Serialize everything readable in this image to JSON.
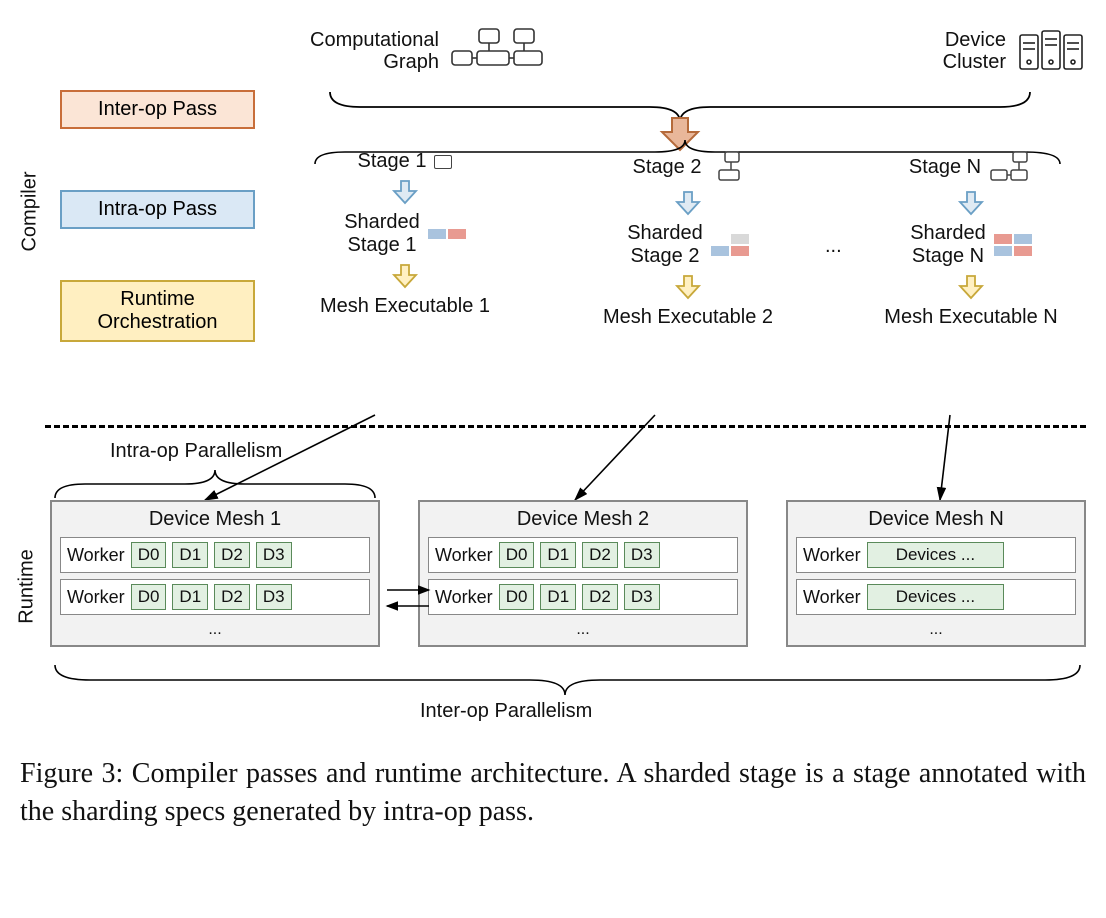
{
  "side_labels": {
    "compiler": "Compiler",
    "runtime": "Runtime"
  },
  "legend": {
    "inter": "Inter-op Pass",
    "intra": "Intra-op Pass",
    "runtime": "Runtime\nOrchestration"
  },
  "top": {
    "comp_graph": "Computational\nGraph",
    "device_cluster": "Device\nCluster"
  },
  "stages": [
    {
      "name": "Stage 1",
      "sharded": "Sharded\nStage 1",
      "mesh_exec": "Mesh Executable 1"
    },
    {
      "name": "Stage 2",
      "sharded": "Sharded\nStage 2",
      "mesh_exec": "Mesh Executable 2"
    },
    {
      "name": "Stage N",
      "sharded": "Sharded\nStage N",
      "mesh_exec": "Mesh Executable N"
    }
  ],
  "ellipsis": "...",
  "intraop_label": "Intra-op Parallelism",
  "meshes": [
    {
      "title": "Device Mesh 1",
      "workers": [
        {
          "label": "Worker",
          "devices": [
            "D0",
            "D1",
            "D2",
            "D3"
          ]
        },
        {
          "label": "Worker",
          "devices": [
            "D0",
            "D1",
            "D2",
            "D3"
          ]
        }
      ]
    },
    {
      "title": "Device Mesh 2",
      "workers": [
        {
          "label": "Worker",
          "devices": [
            "D0",
            "D1",
            "D2",
            "D3"
          ]
        },
        {
          "label": "Worker",
          "devices": [
            "D0",
            "D1",
            "D2",
            "D3"
          ]
        }
      ]
    },
    {
      "title": "Device Mesh N",
      "workers": [
        {
          "label": "Worker",
          "devices_single": "Devices ..."
        },
        {
          "label": "Worker",
          "devices_single": "Devices ..."
        }
      ]
    }
  ],
  "interop_label": "Inter-op Parallelism",
  "caption": "Figure 3: Compiler passes and runtime architecture. A sharded stage is a stage annotated with the sharding specs generated by intra-op pass.",
  "colors": {
    "inter_bg": "#fbe5d6",
    "intra_bg": "#dae8f5",
    "runtime_bg": "#ffefc1",
    "mesh_bg": "#f2f2f2",
    "device_bg": "#e2f0e2"
  }
}
